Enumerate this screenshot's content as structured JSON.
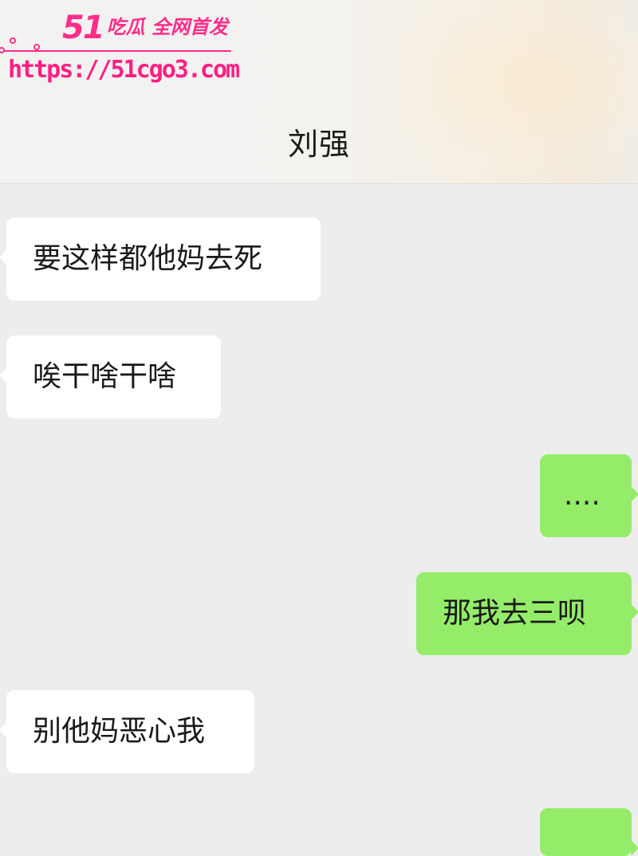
{
  "watermark": {
    "brand_number": "51",
    "brand_text": "吃瓜 全网首发",
    "url": "https://51cgo3.com"
  },
  "chat": {
    "title": "刘强",
    "messages": [
      {
        "side": "left",
        "text": "要这样都他妈去死"
      },
      {
        "side": "left",
        "text": "唉干啥干啥"
      },
      {
        "side": "right",
        "text": "...."
      },
      {
        "side": "right",
        "text": "那我去三呗"
      },
      {
        "side": "left",
        "text": "别他妈恶心我"
      },
      {
        "side": "right",
        "text": ""
      }
    ]
  },
  "colors": {
    "background": "#ededed",
    "incoming_bubble": "#ffffff",
    "outgoing_bubble": "#95ec69",
    "watermark": "#ff2d8a"
  }
}
